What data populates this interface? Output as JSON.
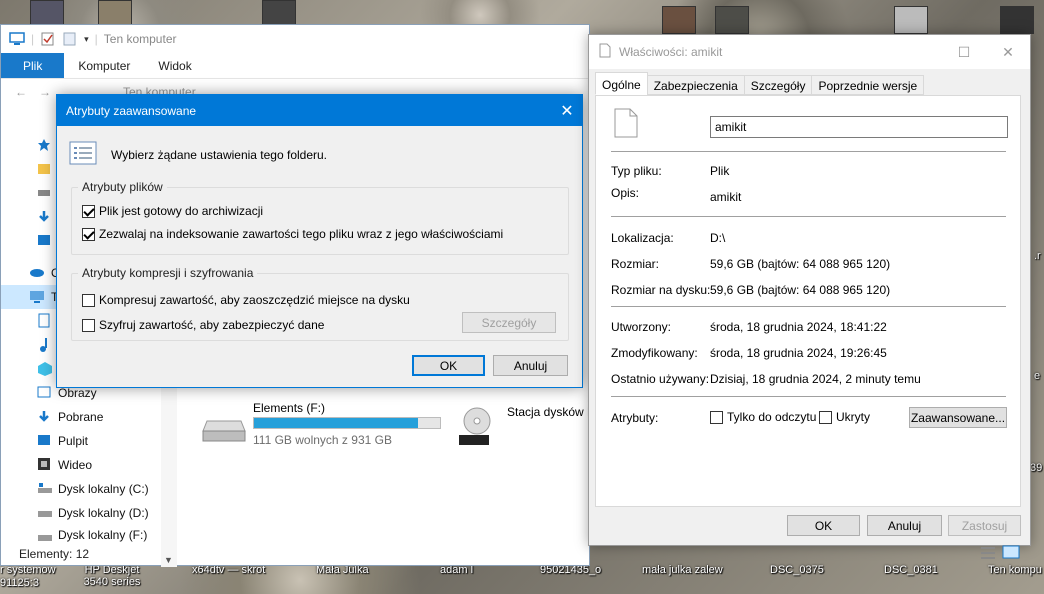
{
  "desktop": {
    "labels": [
      "r systemow",
      "91125:3",
      "HP Deskjet 3540 series",
      "x64dtv — skrot",
      "Mała Julka",
      "adam l",
      "95021435_o",
      "mała julka zalew",
      "DSC_0375",
      "DSC_0381",
      "Ten kompu"
    ],
    "right_edge_labels": [
      ".r",
      "e",
      "39"
    ]
  },
  "explorer": {
    "title": "Ten komputer",
    "ribbon_tabs": [
      "Plik",
      "Komputer",
      "Widok"
    ],
    "address": "Ten komputer",
    "nav_items": [
      {
        "label": "S",
        "icon": "star-icon"
      },
      {
        "label": "",
        "icon": "folder-icon"
      },
      {
        "label": "",
        "icon": "drive-icon"
      },
      {
        "label": "",
        "icon": "download-icon"
      },
      {
        "label": "",
        "icon": "monitor-icon"
      },
      {
        "label": "O",
        "icon": "cloud-icon"
      },
      {
        "label": "Te",
        "icon": "computer-icon"
      },
      {
        "label": "",
        "icon": "document-icon"
      },
      {
        "label": "",
        "icon": "music-icon"
      },
      {
        "label": "",
        "icon": "cube-icon"
      },
      {
        "label": "Obrazy",
        "icon": "pictures-icon"
      },
      {
        "label": "Pobrane",
        "icon": "download-icon"
      },
      {
        "label": "Pulpit",
        "icon": "desktop-icon"
      },
      {
        "label": "Wideo",
        "icon": "video-icon"
      },
      {
        "label": "Dysk lokalny (C:)",
        "icon": "windows-drive-icon"
      },
      {
        "label": "Dysk lokalny (D:)",
        "icon": "drive-icon"
      },
      {
        "label": "Dysk lokalny (F:)",
        "icon": "drive-icon"
      }
    ],
    "drive_elements": {
      "name": "Elements (F:)",
      "free": "111 GB wolnych z 931 GB",
      "used_fraction": 0.88
    },
    "drive_dvd": {
      "name": "Stacja dysków D",
      "badge": "DVD"
    },
    "status": "Elementy: 12"
  },
  "properties": {
    "title": "Właściwości: amikit",
    "tabs": [
      "Ogólne",
      "Zabezpieczenia",
      "Szczegóły",
      "Poprzednie wersje"
    ],
    "name_value": "amikit",
    "fields": {
      "type_label": "Typ pliku:",
      "type_value": "Plik",
      "desc_label": "Opis:",
      "desc_value": "amikit",
      "location_label": "Lokalizacja:",
      "location_value": "D:\\",
      "size_label": "Rozmiar:",
      "size_value": "59,6 GB (bajtów: 64 088 965 120)",
      "disk_size_label": "Rozmiar na dysku:",
      "disk_size_value": "59,6 GB (bajtów: 64 088 965 120)",
      "created_label": "Utworzony:",
      "created_value": "środa, 18 grudnia 2024, 18:41:22",
      "modified_label": "Zmodyfikowany:",
      "modified_value": "środa, 18 grudnia 2024, 19:26:45",
      "accessed_label": "Ostatnio używany:",
      "accessed_value": "Dzisiaj, 18 grudnia 2024, 2 minuty temu",
      "attributes_label": "Atrybuty:"
    },
    "readonly_label": "Tylko do odczytu",
    "hidden_label": "Ukryty",
    "advanced_button": "Zaawansowane...",
    "ok": "OK",
    "cancel": "Anuluj",
    "apply": "Zastosuj"
  },
  "advanced": {
    "title": "Atrybuty zaawansowane",
    "intro": "Wybierz żądane ustawienia tego folderu.",
    "group1": "Atrybuty plików",
    "archive": "Plik jest gotowy do archiwizacji",
    "index": "Zezwalaj na indeksowanie zawartości tego pliku wraz z jego właściwościami",
    "group2": "Atrybuty kompresji i szyfrowania",
    "compress": "Kompresuj zawartość, aby zaoszczędzić miejsce na dysku",
    "encrypt": "Szyfruj zawartość, aby zabezpieczyć dane",
    "details_button": "Szczegóły",
    "ok": "OK",
    "cancel": "Anuluj"
  },
  "colors": {
    "accent": "#0078d7",
    "ribbon_file": "#1979ca",
    "selection": "#cce8ff",
    "progress": "#26a0da"
  }
}
